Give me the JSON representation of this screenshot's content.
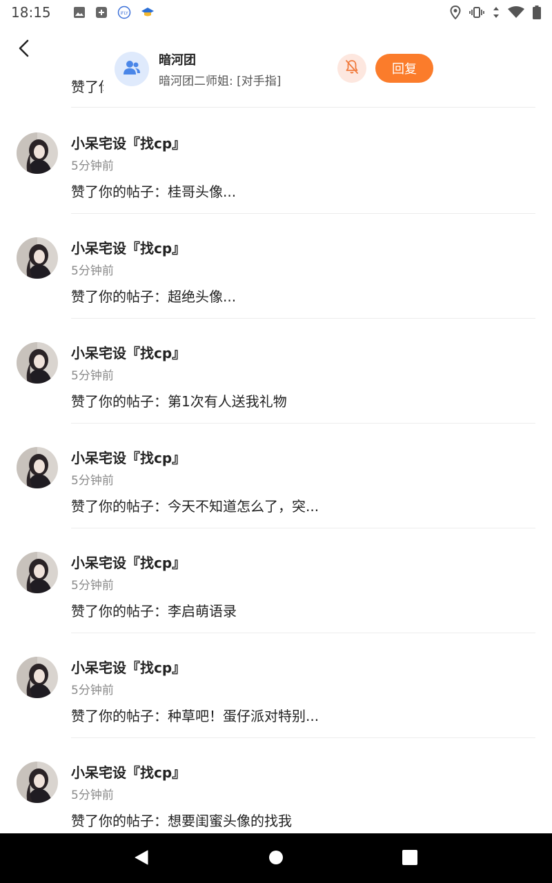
{
  "status_bar": {
    "time": "18:15",
    "left_icons": [
      "image-icon",
      "add-box-icon",
      "ifly-icon",
      "mortarboard-icon"
    ],
    "right_icons": [
      "location-icon",
      "vibrate-icon",
      "data-arrows-icon",
      "wifi-icon",
      "battery-icon"
    ]
  },
  "header": {
    "back_icon": "chevron-left-icon"
  },
  "notification": {
    "title": "暗河团",
    "subtitle": "暗河团二师姐: [对手指]",
    "mute_icon": "bell-off-icon",
    "reply_label": "回复",
    "colors": {
      "reply_bg": "#fb7c2b",
      "mute_bg": "#fde7df",
      "avatar_bg": "#dfeafc",
      "avatar_icon": "#4a86e8"
    }
  },
  "partial_item": {
    "content": "赞了你的帖子"
  },
  "items": [
    {
      "name": "小呆宅设『找cp』",
      "time": "5分钟前",
      "content": "赞了你的帖子：桂哥头像..."
    },
    {
      "name": "小呆宅设『找cp』",
      "time": "5分钟前",
      "content": "赞了你的帖子：超绝头像..."
    },
    {
      "name": "小呆宅设『找cp』",
      "time": "5分钟前",
      "content": "赞了你的帖子：第1次有人送我礼物"
    },
    {
      "name": "小呆宅设『找cp』",
      "time": "5分钟前",
      "content": "赞了你的帖子：今天不知道怎么了，突..."
    },
    {
      "name": "小呆宅设『找cp』",
      "time": "5分钟前",
      "content": "赞了你的帖子：李启萌语录"
    },
    {
      "name": "小呆宅设『找cp』",
      "time": "5分钟前",
      "content": "赞了你的帖子：种草吧！蛋仔派对特别..."
    },
    {
      "name": "小呆宅设『找cp』",
      "time": "5分钟前",
      "content": "赞了你的帖子：想要闺蜜头像的找我"
    }
  ],
  "nav_bar": {
    "back_icon": "triangle-back-icon",
    "home_icon": "circle-home-icon",
    "recents_icon": "square-recents-icon"
  }
}
